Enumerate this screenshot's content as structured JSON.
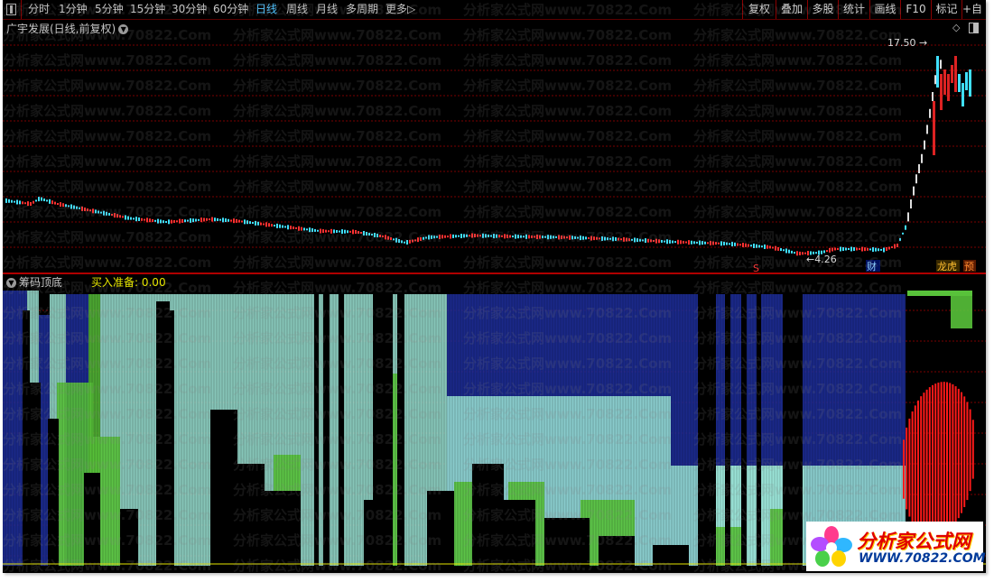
{
  "toolbar": {
    "periods": [
      {
        "label": "分时",
        "active": false
      },
      {
        "label": "1分钟",
        "active": false
      },
      {
        "label": "5分钟",
        "active": false
      },
      {
        "label": "15分钟",
        "active": false
      },
      {
        "label": "30分钟",
        "active": false
      },
      {
        "label": "60分钟",
        "active": false
      },
      {
        "label": "日线",
        "active": true
      },
      {
        "label": "周线",
        "active": false
      },
      {
        "label": "月线",
        "active": false
      },
      {
        "label": "多周期",
        "active": false
      },
      {
        "label": "更多",
        "active": false
      }
    ],
    "more_arrow": "▷",
    "right_buttons": [
      "复权",
      "叠加",
      "多股",
      "统计",
      "画线",
      "F10",
      "标记",
      "+自"
    ]
  },
  "price_panel": {
    "title": "广宇发展(日线,前复权)",
    "high_label": "17.50",
    "low_label": "4.26",
    "marker_s": "S",
    "marker_cai": "财",
    "badge_longhu": "龙虎",
    "badge_yu": "预",
    "icons": {
      "dropdown": "chevron-down-icon",
      "diamond": "diamond-icon",
      "restore": "restore-icon"
    }
  },
  "indicator_panel": {
    "title": "筹码顶底",
    "value_label": "买入准备: 0.00"
  },
  "colors": {
    "background": "#000000",
    "grid": "#7a0000",
    "candle_up": "#ff3030",
    "candle_down": "#40e0ff",
    "navy": "#1f2fa0",
    "teal": "#9ee8d8",
    "green": "#58c23a",
    "red_bars": "#ff1a1a",
    "value_text": "#e6e600",
    "active_tab": "#4fc3ff"
  },
  "watermark": {
    "text": "分析家公式网www.70822.Com"
  },
  "logo": {
    "name": "分析家公式网",
    "url": "WWW.70822.COM"
  }
}
